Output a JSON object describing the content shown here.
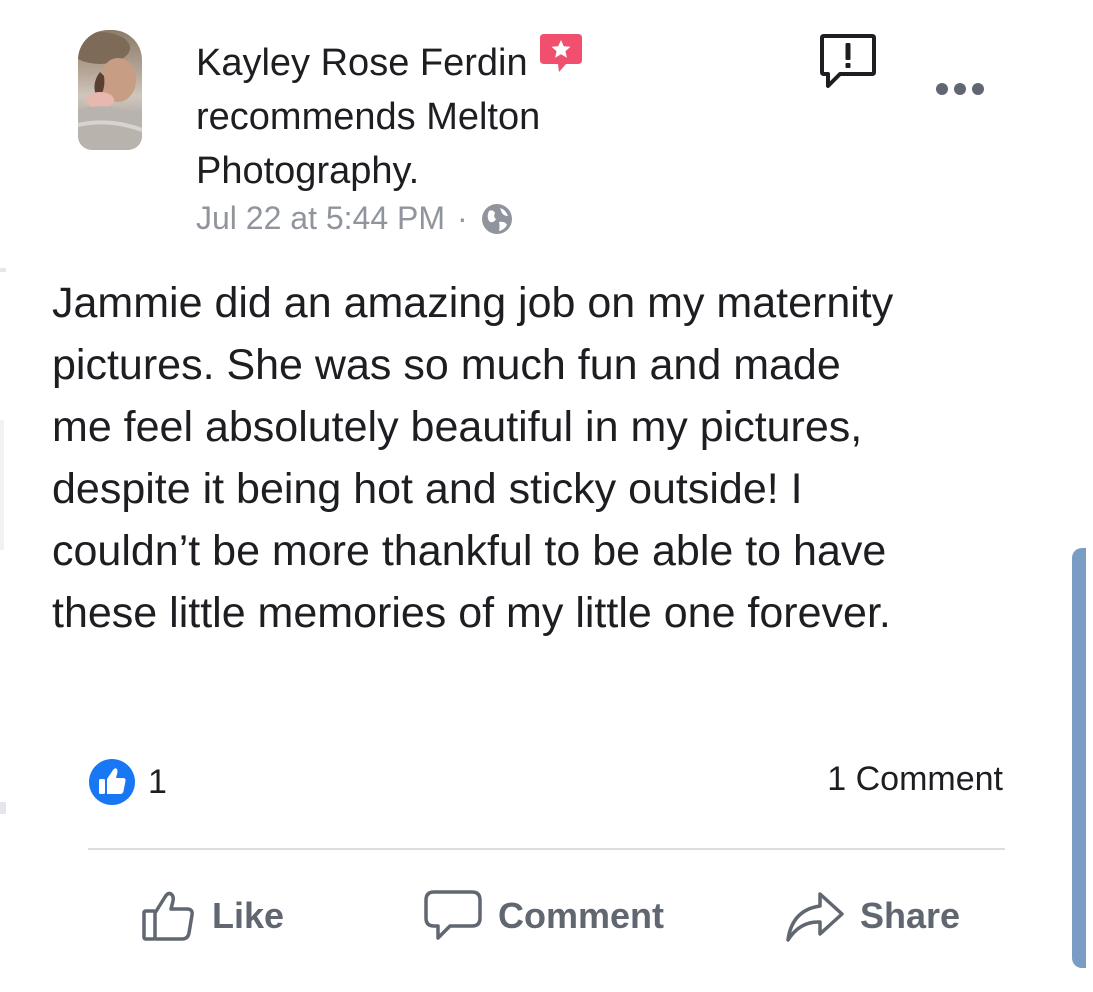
{
  "post": {
    "author": "Kayley Rose Ferdin",
    "headline_line1": "Kayley Rose Ferdin",
    "headline_line2": "recommends Melton",
    "headline_line3": "Photography.",
    "timestamp": "Jul 22 at 5:44 PM",
    "separator": "·",
    "privacy_icon": "globe-icon",
    "body_lines": [
      "Jammie did an amazing job on my maternity",
      "pictures. She was so much fun and made",
      "me feel absolutely beautiful in my pictures,",
      "despite it being hot and sticky outside! I",
      "couldn’t be more thankful to be able to have",
      "these little memories of my little one forever."
    ]
  },
  "stats": {
    "like_count": "1",
    "comments_label": "1 Comment"
  },
  "actions": {
    "like": "Like",
    "comment": "Comment",
    "share": "Share"
  },
  "icons": {
    "recommend_badge": "recommendation-star-icon",
    "report": "report-icon",
    "more": "more-options-icon",
    "like_reaction": "like-reaction-icon"
  },
  "colors": {
    "text": "#1c1e21",
    "meta": "#90949c",
    "action": "#606770",
    "like_blue": "#1877f2",
    "recommend_red": "#f0506e",
    "scroll_indicator": "#7a9dc6"
  }
}
